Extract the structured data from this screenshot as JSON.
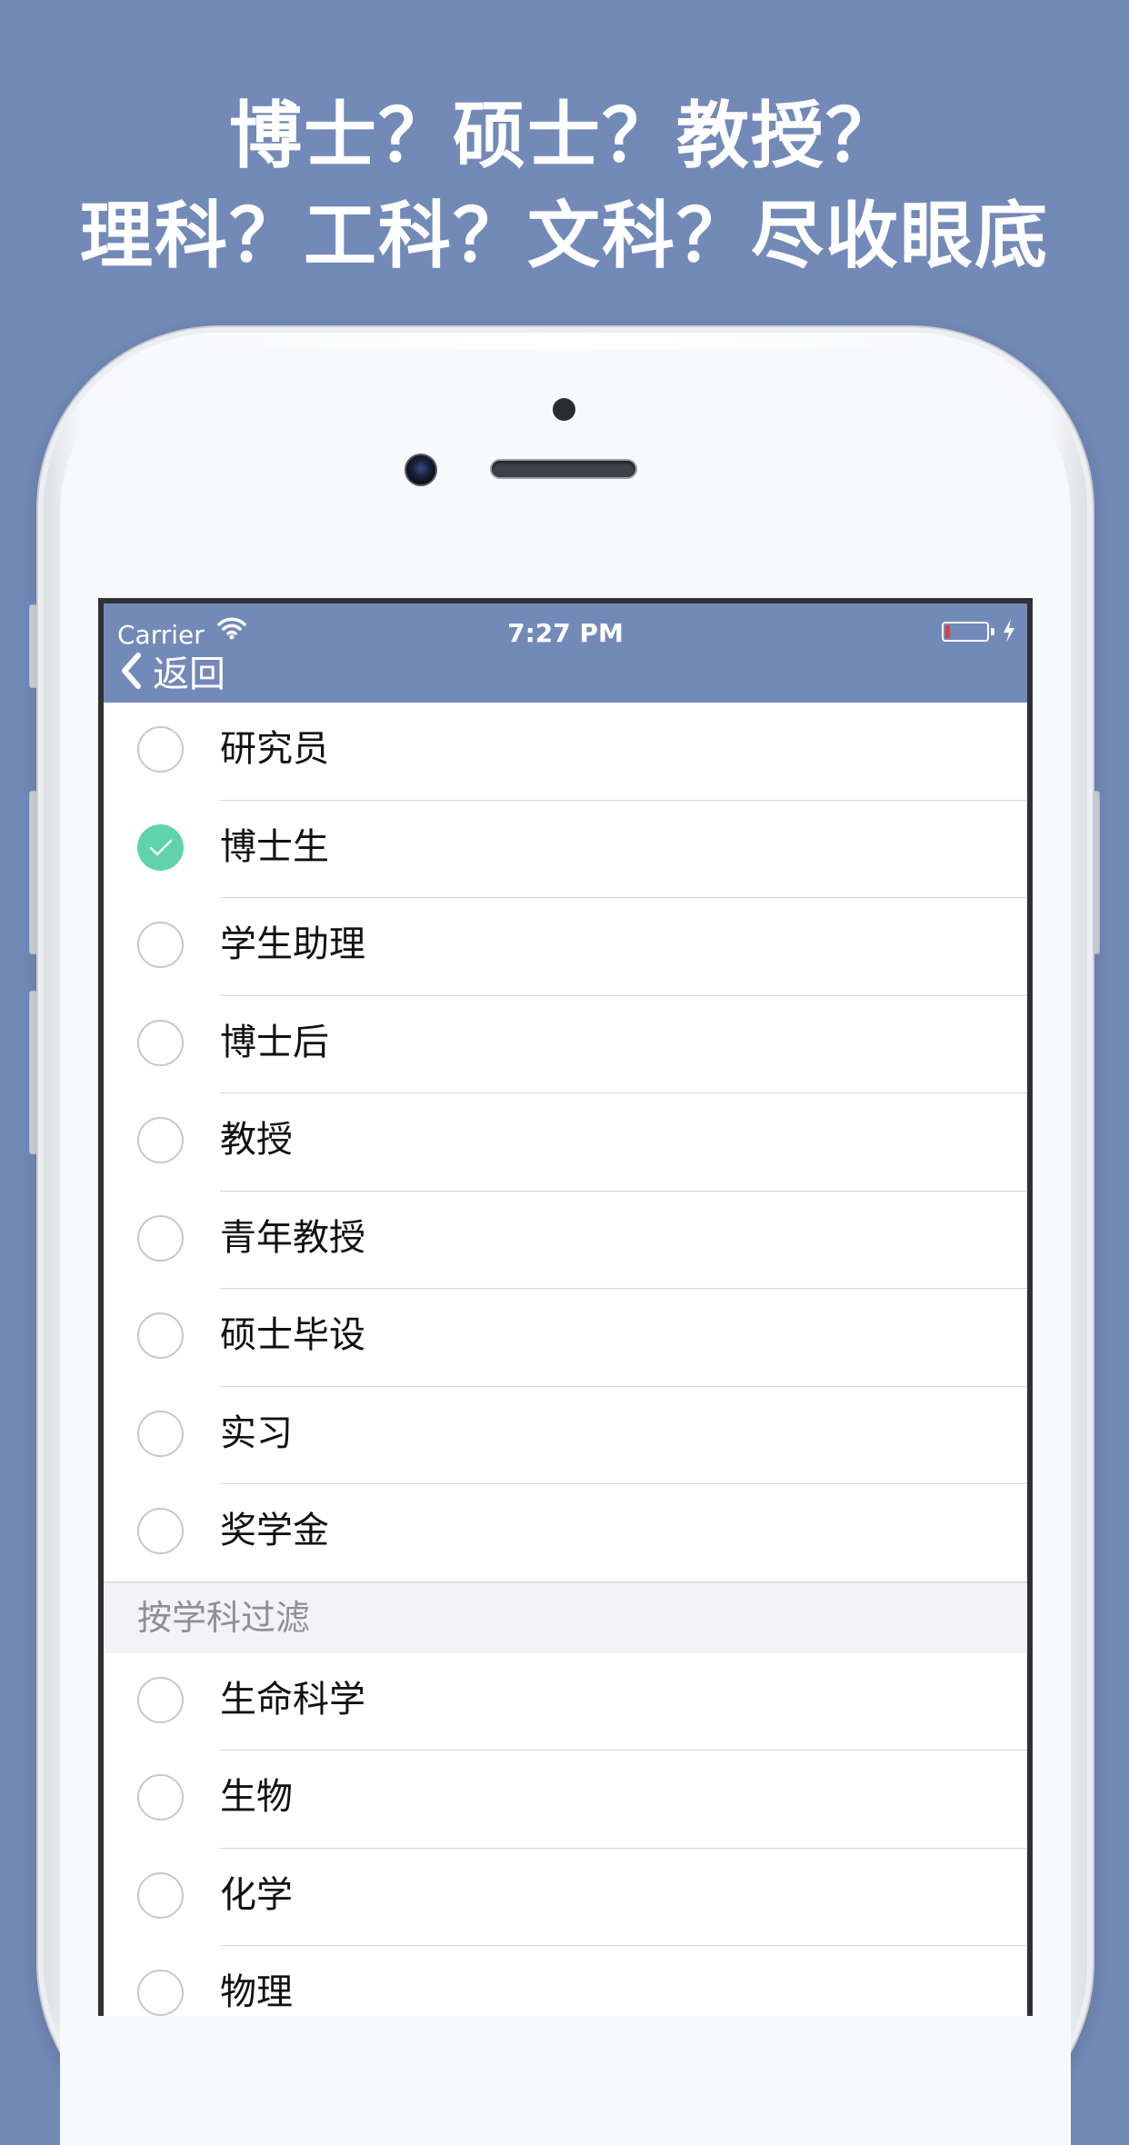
{
  "headline": {
    "line1": "博士？硕士？教授？",
    "line2": "理科？工科？文科？尽收眼底"
  },
  "status_bar": {
    "carrier": "Carrier",
    "time": "7:27 PM",
    "battery_level": 0.05
  },
  "nav": {
    "back_label": "返回"
  },
  "colors": {
    "background": "#738ab8",
    "nav_bar": "#738ab8",
    "check_accent": "#5ed3ac"
  },
  "position_filter": {
    "items": [
      {
        "label": "研究员",
        "checked": false
      },
      {
        "label": "博士生",
        "checked": true
      },
      {
        "label": "学生助理",
        "checked": false
      },
      {
        "label": "博士后",
        "checked": false
      },
      {
        "label": "教授",
        "checked": false
      },
      {
        "label": "青年教授",
        "checked": false
      },
      {
        "label": "硕士毕设",
        "checked": false
      },
      {
        "label": "实习",
        "checked": false
      },
      {
        "label": "奖学金",
        "checked": false
      }
    ]
  },
  "subject_filter": {
    "header": "按学科过滤",
    "items": [
      {
        "label": "生命科学",
        "checked": false
      },
      {
        "label": "生物",
        "checked": false
      },
      {
        "label": "化学",
        "checked": false
      },
      {
        "label": "物理",
        "checked": false
      }
    ]
  }
}
